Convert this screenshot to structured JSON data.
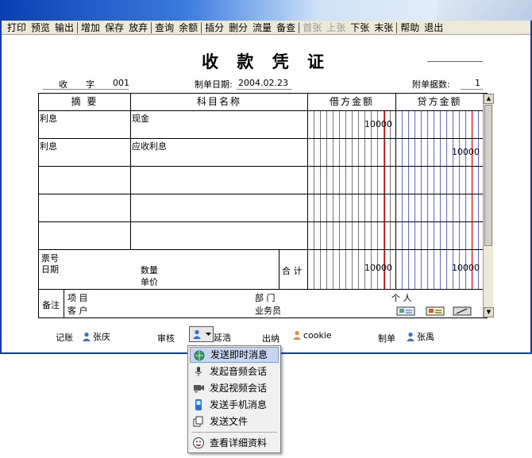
{
  "menubar": [
    {
      "label": "打印",
      "enabled": true
    },
    {
      "label": "预览",
      "enabled": true
    },
    {
      "label": "输出",
      "enabled": true
    },
    {
      "sep": true
    },
    {
      "label": "增加",
      "enabled": true
    },
    {
      "label": "保存",
      "enabled": true
    },
    {
      "label": "放弃",
      "enabled": true
    },
    {
      "sep": true
    },
    {
      "label": "查询",
      "enabled": true
    },
    {
      "label": "余额",
      "enabled": true
    },
    {
      "sep": true
    },
    {
      "label": "插分",
      "enabled": true
    },
    {
      "label": "删分",
      "enabled": true
    },
    {
      "label": "流量",
      "enabled": true
    },
    {
      "label": "备查",
      "enabled": true
    },
    {
      "sep": true
    },
    {
      "label": "首张",
      "enabled": false
    },
    {
      "label": "上张",
      "enabled": false
    },
    {
      "label": "下张",
      "enabled": true
    },
    {
      "label": "末张",
      "enabled": true
    },
    {
      "sep": true
    },
    {
      "label": "帮助",
      "enabled": true
    },
    {
      "label": "退出",
      "enabled": true
    }
  ],
  "voucher": {
    "title": "收 款 凭 证",
    "type_char": "收",
    "zi_label": "字",
    "number": "001",
    "date_label": "制单日期:",
    "date": "2004.02.23",
    "attach_label": "附单据数:",
    "attach_count": "1",
    "headers": {
      "summary": "摘 要",
      "account": "科目名称",
      "debit": "借方金额",
      "credit": "贷方金额"
    },
    "rows": [
      {
        "summary": "利息",
        "account": "现金",
        "debit": "10000",
        "credit": ""
      },
      {
        "summary": "利息",
        "account": "应收利息",
        "debit": "",
        "credit": "10000"
      },
      {
        "summary": "",
        "account": "",
        "debit": "",
        "credit": ""
      },
      {
        "summary": "",
        "account": "",
        "debit": "",
        "credit": ""
      },
      {
        "summary": "",
        "account": "",
        "debit": "",
        "credit": ""
      }
    ],
    "ticket_label": "票号",
    "date_row_label": "日期",
    "qty_label": "数量",
    "price_label": "单价",
    "total_label": "合 计",
    "total_debit": "10000",
    "total_credit": "10000",
    "remark_label": "备注",
    "project_label": "项  目",
    "customer_label": "客  户",
    "dept_label": "部  门",
    "person_label": "个  人",
    "salesman_label": "业务员"
  },
  "footer": {
    "bookkeeper_label": "记账",
    "bookkeeper": "张庆",
    "auditor_label": "审核",
    "auditor": "延浩",
    "cashier_label": "出纳",
    "cashier": "cookie",
    "maker_label": "制单",
    "maker": "张禹"
  },
  "context_menu": [
    {
      "label": "发送即时消息",
      "icon": "globe-chat-icon",
      "selected": true
    },
    {
      "label": "发起音频会话",
      "icon": "microphone-icon",
      "selected": false
    },
    {
      "label": "发起视频会话",
      "icon": "video-camera-icon",
      "selected": false
    },
    {
      "label": "发送手机消息",
      "icon": "mobile-phone-icon",
      "selected": false
    },
    {
      "label": "发送文件",
      "icon": "file-copy-icon",
      "selected": false
    },
    {
      "label": "查看详细资料",
      "icon": "smiley-face-icon",
      "selected": false
    }
  ],
  "colors": {
    "title_bar": "#0a3fb0",
    "grid_blue": "#6b6bd8",
    "grid_red": "#dd0000",
    "menu_selected": "#c7d6ee"
  }
}
